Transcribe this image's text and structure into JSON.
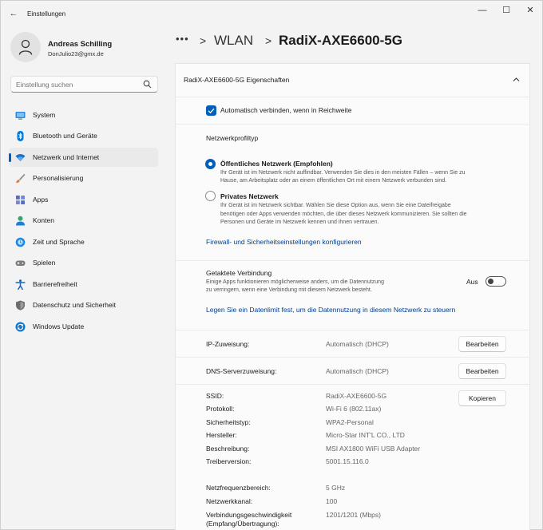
{
  "window": {
    "app_title": "Einstellungen",
    "controls": {
      "minimize": "—",
      "maximize": "☐",
      "close": "✕"
    }
  },
  "user": {
    "name": "Andreas Schilling",
    "email": "DonJulio23@gmx.de"
  },
  "search": {
    "placeholder": "Einstellung suchen"
  },
  "sidebar": {
    "items": [
      {
        "label": "System",
        "icon": "system-icon",
        "color": "#2b88d8"
      },
      {
        "label": "Bluetooth und Geräte",
        "icon": "bluetooth-icon",
        "color": "#0078d4"
      },
      {
        "label": "Netzwerk und Internet",
        "icon": "wifi-icon",
        "color": "#1f6fcf",
        "active": true
      },
      {
        "label": "Personalisierung",
        "icon": "brush-icon",
        "color": "#e8773b"
      },
      {
        "label": "Apps",
        "icon": "apps-icon",
        "color": "#5c6bc0"
      },
      {
        "label": "Konten",
        "icon": "person-icon",
        "color": "#2aa876"
      },
      {
        "label": "Zeit und Sprache",
        "icon": "globe-clock-icon",
        "color": "#1e88e5"
      },
      {
        "label": "Spielen",
        "icon": "gamepad-icon",
        "color": "#7a7a7a"
      },
      {
        "label": "Barrierefreiheit",
        "icon": "accessibility-icon",
        "color": "#1565c0"
      },
      {
        "label": "Datenschutz und Sicherheit",
        "icon": "shield-icon",
        "color": "#6d6d6d"
      },
      {
        "label": "Windows Update",
        "icon": "update-icon",
        "color": "#0a78d6"
      }
    ]
  },
  "breadcrumb": {
    "more": "•••",
    "sep": ">",
    "parent": "WLAN",
    "current": "RadiX-AXE6600-5G"
  },
  "properties": {
    "header": "RadiX-AXE6600-5G Eigenschaften",
    "auto_connect": "Automatisch verbinden, wenn in Reichweite",
    "profile_type_label": "Netzwerkprofiltyp",
    "public": {
      "title": "Öffentliches Netzwerk (Empfohlen)",
      "desc_1": "Ihr Gerät ist im Netzwerk nicht auffindbar. Verwenden Sie dies in den meisten Fällen – wenn Sie zu",
      "desc_2": "Hause, am Arbeitsplatz oder an einem öffentlichen Ort mit einem Netzwerk verbunden sind."
    },
    "private": {
      "title": "Privates Netzwerk",
      "desc_1": "Ihr Gerät ist im Netzwerk sichtbar. Wählen Sie diese Option aus, wenn Sie eine Dateifreigabe",
      "desc_2": "benötigen oder Apps verwenden möchten, die über dieses Netzwerk kommunizieren. Sie sollten die",
      "desc_3": "Personen und Geräte im Netzwerk kennen und ihnen vertrauen."
    },
    "firewall_link": "Firewall- und Sicherheitseinstellungen konfigurieren",
    "metered": {
      "title": "Getaktete Verbindung",
      "desc_1": "Einige Apps funktionieren möglicherweise anders, um die Datennutzung",
      "desc_2": "zu verringern, wenn eine Verbindung mit diesem Netzwerk besteht.",
      "state": "Aus"
    },
    "data_limit_link": "Legen Sie ein Datenlimit fest, um die Datennutzung in diesem Netzwerk zu steuern",
    "ip": {
      "label": "IP-Zuweisung:",
      "value": "Automatisch (DHCP)",
      "button": "Bearbeiten"
    },
    "dns": {
      "label": "DNS-Serverzuweisung:",
      "value": "Automatisch (DHCP)",
      "button": "Bearbeiten"
    },
    "copy_button": "Kopieren",
    "details": [
      {
        "label": "SSID:",
        "value": "RadiX-AXE6600-5G"
      },
      {
        "label": "Protokoll:",
        "value": "Wi-Fi 6 (802.11ax)"
      },
      {
        "label": "Sicherheitstyp:",
        "value": "WPA2-Personal"
      },
      {
        "label": "Hersteller:",
        "value": "Micro-Star INT'L CO., LTD"
      },
      {
        "label": "Beschreibung:",
        "value": "MSI AX1800 WiFi USB Adapter"
      },
      {
        "label": "Treiberversion:",
        "value": "5001.15.116.0"
      },
      {
        "label": "Netzfrequenzbereich:",
        "value": "5 GHz"
      },
      {
        "label": "Netzwerkkanal:",
        "value": "100"
      },
      {
        "label": "Verbindungsgeschwindigkeit",
        "label_2": "(Empfang/Übertragung):",
        "value": "1201/1201 (Mbps)"
      }
    ]
  }
}
